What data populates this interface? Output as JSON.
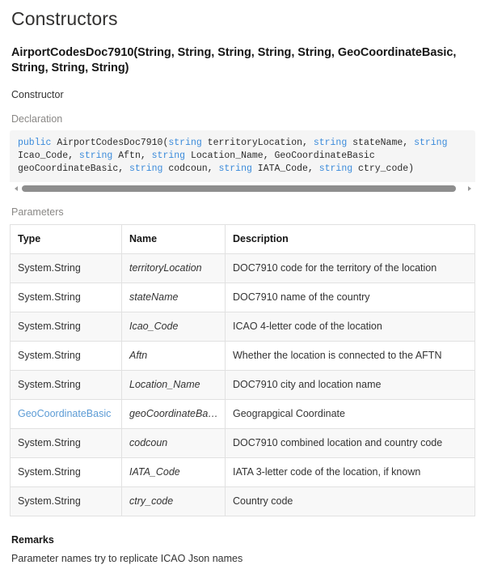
{
  "page": {
    "title": "Constructors"
  },
  "member": {
    "signature": "AirportCodesDoc7910(String, String, String, String, String, GeoCoordinateBasic, String, String, String)",
    "summary": "Constructor"
  },
  "declaration": {
    "label": "Declaration",
    "code_segments": [
      {
        "text": "public",
        "kind": "keyword"
      },
      {
        "text": " AirportCodesDoc7910(",
        "kind": "plain"
      },
      {
        "text": "string",
        "kind": "keyword"
      },
      {
        "text": " territoryLocation, ",
        "kind": "plain"
      },
      {
        "text": "string",
        "kind": "keyword"
      },
      {
        "text": " stateName, ",
        "kind": "plain"
      },
      {
        "text": "string",
        "kind": "keyword"
      },
      {
        "text": " Icao_Code, ",
        "kind": "plain"
      },
      {
        "text": "string",
        "kind": "keyword"
      },
      {
        "text": " Aftn, ",
        "kind": "plain"
      },
      {
        "text": "string",
        "kind": "keyword"
      },
      {
        "text": " Location_Name, GeoCoordinateBasic geoCoordinateBasic, ",
        "kind": "plain"
      },
      {
        "text": "string",
        "kind": "keyword"
      },
      {
        "text": " codcoun, ",
        "kind": "plain"
      },
      {
        "text": "string",
        "kind": "keyword"
      },
      {
        "text": " IATA_Code, ",
        "kind": "plain"
      },
      {
        "text": "string",
        "kind": "keyword"
      },
      {
        "text": " ctry_code)",
        "kind": "plain"
      }
    ],
    "keyword_color": "#3b8bdb",
    "background_color": "#f5f5f5"
  },
  "scrollbar": {
    "left_arrow": "triangle-left",
    "right_arrow": "triangle-right",
    "thumb_color": "#8e8e8e"
  },
  "parameters": {
    "label": "Parameters",
    "columns": [
      "Type",
      "Name",
      "Description"
    ],
    "rows": [
      {
        "type": "System.String",
        "type_is_link": false,
        "name": "territoryLocation",
        "description": "DOC7910 code for the territory of the location"
      },
      {
        "type": "System.String",
        "type_is_link": false,
        "name": "stateName",
        "description": "DOC7910 name of the country"
      },
      {
        "type": "System.String",
        "type_is_link": false,
        "name": "Icao_Code",
        "description": "ICAO 4-letter code of the location"
      },
      {
        "type": "System.String",
        "type_is_link": false,
        "name": "Aftn",
        "description": "Whether the location is connected to the AFTN"
      },
      {
        "type": "System.String",
        "type_is_link": false,
        "name": "Location_Name",
        "description": "DOC7910 city and location name"
      },
      {
        "type": "GeoCoordinateBasic",
        "type_is_link": true,
        "name": "geoCoordinateBasic",
        "description": "Geograpgical Coordinate"
      },
      {
        "type": "System.String",
        "type_is_link": false,
        "name": "codcoun",
        "description": "DOC7910 combined location and country code"
      },
      {
        "type": "System.String",
        "type_is_link": false,
        "name": "IATA_Code",
        "description": "IATA 3-letter code of the location, if known"
      },
      {
        "type": "System.String",
        "type_is_link": false,
        "name": "ctry_code",
        "description": "Country code"
      }
    ],
    "link_color": "#5b9bd5",
    "stripe_color": "#f8f8f8",
    "border_color": "#e1e1e1"
  },
  "remarks": {
    "title": "Remarks",
    "body": "Parameter names try to replicate ICAO Json names"
  }
}
